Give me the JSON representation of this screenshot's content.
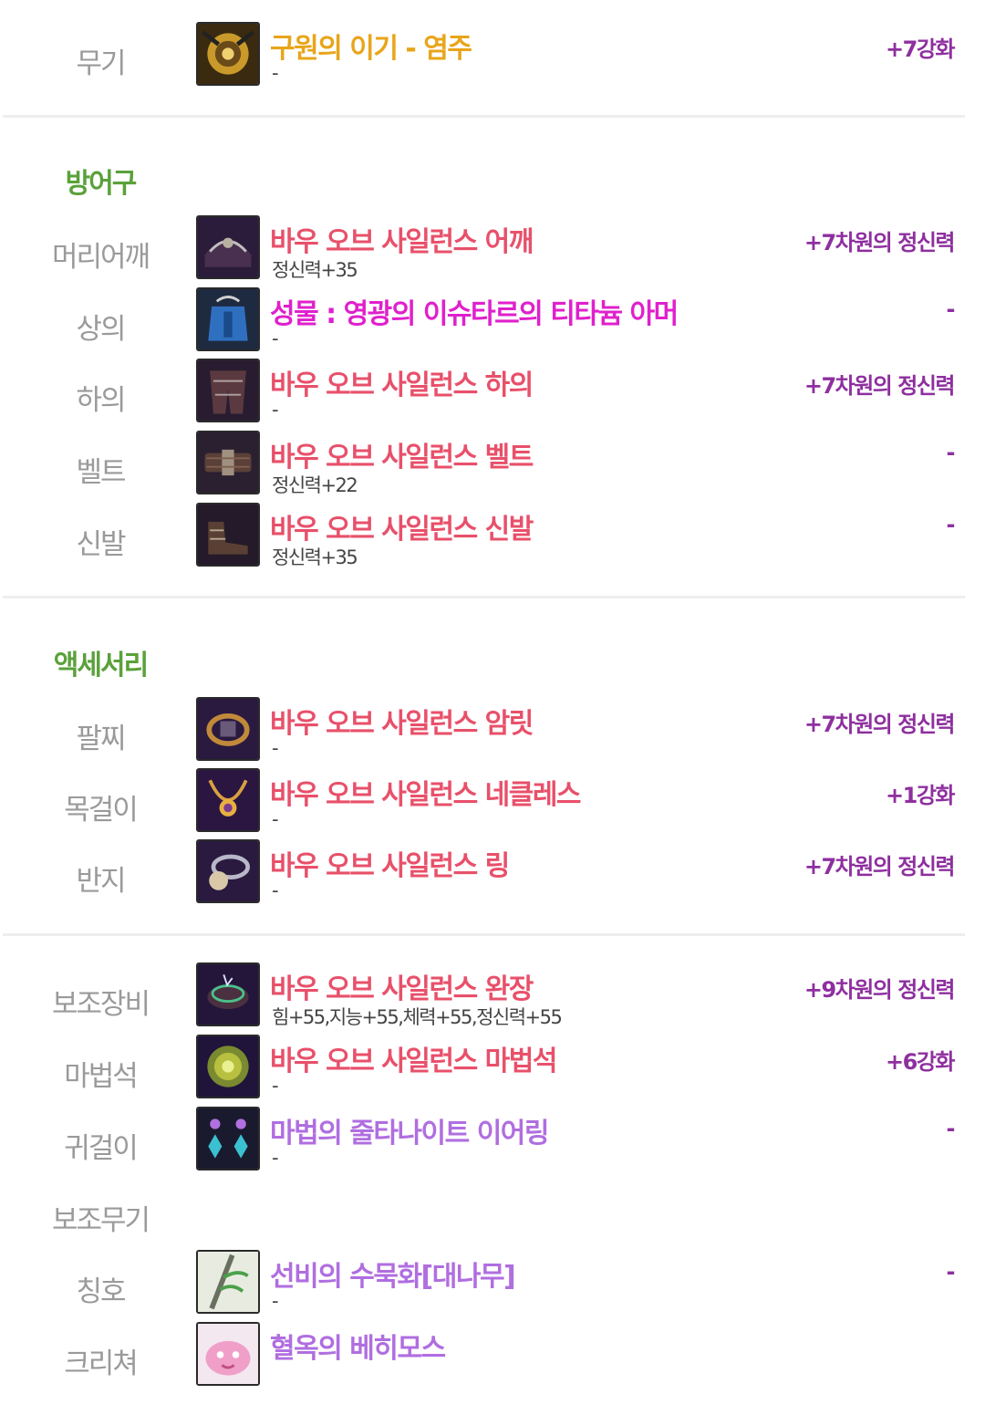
{
  "colors": {
    "slot_label": "#9a9a9a",
    "section_title": "#5aa13a",
    "enhance": "#8e2f9f",
    "unique": "#e8a51a",
    "legendary_red": "#e8506a",
    "epic_magenta": "#e020cc",
    "epic_purple": "#b06ee0",
    "divider": "#eeeeee"
  },
  "weapon": {
    "slot": "무기",
    "icon": "weapon-icon",
    "name": "구원의 이기 - 염주",
    "sub": "-",
    "right": "+7강화"
  },
  "armor": {
    "title": "방어구",
    "items": [
      {
        "slot": "머리어깨",
        "icon": "shoulder-icon",
        "name": "바우 오브 사일런스 어깨",
        "sub": "정신력+35",
        "right": "+7차원의 정신력"
      },
      {
        "slot": "상의",
        "icon": "top-icon",
        "name": "성물 : 영광의 이슈타르의 티타늄 아머",
        "sub": "-",
        "right": "-"
      },
      {
        "slot": "하의",
        "icon": "bottom-icon",
        "name": "바우 오브 사일런스 하의",
        "sub": "-",
        "right": "+7차원의 정신력"
      },
      {
        "slot": "벨트",
        "icon": "belt-icon",
        "name": "바우 오브 사일런스 벨트",
        "sub": "정신력+22",
        "right": "-"
      },
      {
        "slot": "신발",
        "icon": "shoes-icon",
        "name": "바우 오브 사일런스 신발",
        "sub": "정신력+35",
        "right": "-"
      }
    ]
  },
  "accessory": {
    "title": "액세서리",
    "items": [
      {
        "slot": "팔찌",
        "icon": "bracelet-icon",
        "name": "바우 오브 사일런스 암릿",
        "sub": "-",
        "right": "+7차원의 정신력"
      },
      {
        "slot": "목걸이",
        "icon": "necklace-icon",
        "name": "바우 오브 사일런스 네클레스",
        "sub": "-",
        "right": "+1강화"
      },
      {
        "slot": "반지",
        "icon": "ring-icon",
        "name": "바우 오브 사일런스 링",
        "sub": "-",
        "right": "+7차원의 정신력"
      }
    ]
  },
  "extra": {
    "items": [
      {
        "slot": "보조장비",
        "icon": "armband-icon",
        "name": "바우 오브 사일런스 완장",
        "sub": "힘+55,지능+55,체력+55,정신력+55",
        "right": "+9차원의 정신력"
      },
      {
        "slot": "마법석",
        "icon": "magic-stone-icon",
        "name": "바우 오브 사일런스 마법석",
        "sub": "-",
        "right": "+6강화"
      },
      {
        "slot": "귀걸이",
        "icon": "earring-icon",
        "name": "마법의 줄타나이트 이어링",
        "sub": "-",
        "right": "-"
      },
      {
        "slot": "보조무기"
      },
      {
        "slot": "칭호",
        "icon": "title-icon",
        "name": "선비의 수묵화[대나무]",
        "sub": "-",
        "right": "-"
      },
      {
        "slot": "크리쳐",
        "icon": "creature-icon",
        "name": "혈옥의 베히모스"
      }
    ]
  }
}
